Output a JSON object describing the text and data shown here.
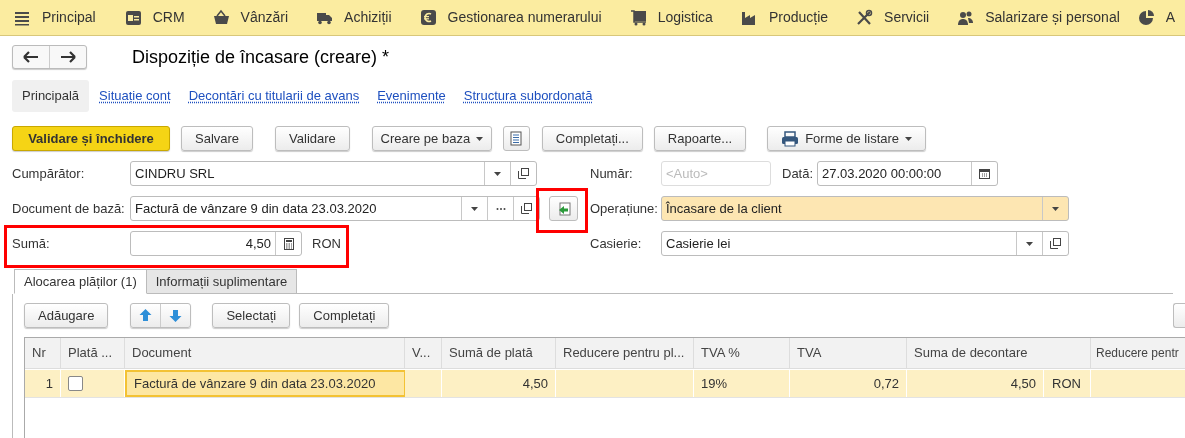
{
  "menu": [
    {
      "label": "Principal"
    },
    {
      "label": "CRM"
    },
    {
      "label": "Vânzări"
    },
    {
      "label": "Achiziții"
    },
    {
      "label": "Gestionarea numerarului"
    },
    {
      "label": "Logistica"
    },
    {
      "label": "Producție"
    },
    {
      "label": "Servicii"
    },
    {
      "label": "Salarizare și personal"
    },
    {
      "label": "A"
    }
  ],
  "window": {
    "title": "Dispoziție de încasare (creare) *"
  },
  "section_tabs": [
    {
      "label": "Principală",
      "selected": true
    },
    {
      "label": "Situație cont",
      "selected": false
    },
    {
      "label": "Decontări cu titularii de avans",
      "selected": false
    },
    {
      "label": "Evenimente",
      "selected": false
    },
    {
      "label": "Structura subordonată",
      "selected": false
    }
  ],
  "toolbar": [
    {
      "kind": "primary",
      "label": "Validare și închidere"
    },
    {
      "kind": "button",
      "label": "Salvare"
    },
    {
      "kind": "button",
      "label": "Validare"
    },
    {
      "kind": "dropdown",
      "label": "Creare pe baza"
    },
    {
      "kind": "icon"
    },
    {
      "kind": "button",
      "label": "Completați..."
    },
    {
      "kind": "button",
      "label": "Rapoarte..."
    },
    {
      "kind": "print",
      "label": "Forme de listare"
    }
  ],
  "fields": {
    "buyer": {
      "label": "Cumpărător:",
      "value": "CINDRU SRL"
    },
    "base_document": {
      "label": "Document de bază:",
      "value": "Factură de vânzare 9 din data 23.03.2020"
    },
    "amount": {
      "label": "Sumă:",
      "value": "4,50",
      "currency": "RON"
    },
    "number": {
      "label": "Număr:",
      "placeholder": "<Auto>"
    },
    "date": {
      "label": "Dată:",
      "value": "27.03.2020 00:00:00"
    },
    "operation": {
      "label": "Operațiune:",
      "value": "Încasare de la client"
    },
    "cash_desk": {
      "label": "Casierie:",
      "value": "Casierie lei"
    }
  },
  "detail_tabs": [
    {
      "label": "Alocarea plăților (1)",
      "selected": true
    },
    {
      "label": "Informații suplimentare",
      "selected": false
    }
  ],
  "table_toolbar": [
    {
      "kind": "button",
      "label": "Adăugare"
    },
    {
      "kind": "arrows"
    },
    {
      "kind": "button",
      "label": "Selectați"
    },
    {
      "kind": "button",
      "label": "Completați"
    }
  ],
  "table": {
    "columns": [
      "Nr",
      "Plată ...",
      "Document",
      "V...",
      "Sumă de plată",
      "Reducere pentru pl...",
      "TVA %",
      "TVA",
      "Suma de decontare",
      "Reducere pentr"
    ],
    "rows": [
      {
        "selected": true,
        "nr": "1",
        "paid": false,
        "document": "Factură de vânzare 9 din data 23.03.2020",
        "payment_sum": "4,50",
        "vat_rate": "19%",
        "vat": "0,72",
        "settlement_sum": "4,50",
        "currency": "RON"
      }
    ]
  }
}
